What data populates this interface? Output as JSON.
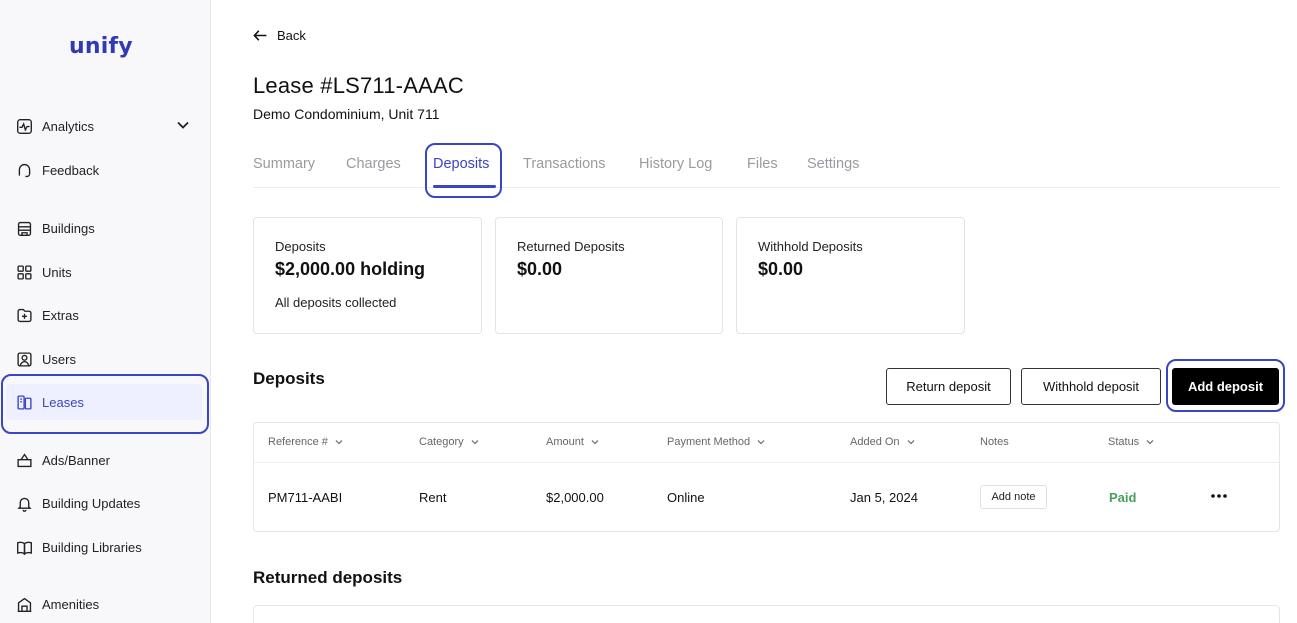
{
  "app": {
    "logo": "unify",
    "accent": "#3a45c4"
  },
  "sidebar": {
    "items": [
      {
        "label": "Analytics",
        "icon": "analytics-icon"
      },
      {
        "label": "Feedback",
        "icon": "feedback-icon"
      },
      {
        "label": "Buildings",
        "icon": "buildings-icon"
      },
      {
        "label": "Units",
        "icon": "units-icon"
      },
      {
        "label": "Extras",
        "icon": "extras-icon"
      },
      {
        "label": "Users",
        "icon": "users-icon"
      },
      {
        "label": "Leases",
        "icon": "leases-icon",
        "active": true
      },
      {
        "label": "Ads/Banner",
        "icon": "ads-icon"
      },
      {
        "label": "Building Updates",
        "icon": "bell-icon"
      },
      {
        "label": "Building Libraries",
        "icon": "book-icon"
      },
      {
        "label": "Amenities",
        "icon": "amenities-icon"
      }
    ]
  },
  "header": {
    "back_label": "Back",
    "title": "Lease #LS711-AAAC",
    "subtitle": "Demo Condominium, Unit 711"
  },
  "tabs": [
    {
      "label": "Summary"
    },
    {
      "label": "Charges"
    },
    {
      "label": "Deposits",
      "active": true
    },
    {
      "label": "Transactions"
    },
    {
      "label": "History Log"
    },
    {
      "label": "Files"
    },
    {
      "label": "Settings"
    }
  ],
  "cards": [
    {
      "label": "Deposits",
      "value": "$2,000.00 holding",
      "note": "All deposits collected"
    },
    {
      "label": "Returned Deposits",
      "value": "$0.00"
    },
    {
      "label": "Withhold Deposits",
      "value": "$0.00"
    }
  ],
  "deposits": {
    "title": "Deposits",
    "buttons": {
      "return": "Return deposit",
      "withhold": "Withhold deposit",
      "add": "Add deposit"
    },
    "columns": [
      "Reference #",
      "Category",
      "Amount",
      "Payment Method",
      "Added On",
      "Notes",
      "Status"
    ],
    "rows": [
      {
        "reference": "PM711-AABI",
        "category": "Rent",
        "amount": "$2,000.00",
        "method": "Online",
        "added_on": "Jan 5, 2024",
        "note_button": "Add note",
        "status": "Paid",
        "status_color": "#4a9e5c"
      }
    ]
  },
  "returned": {
    "title": "Returned deposits"
  }
}
